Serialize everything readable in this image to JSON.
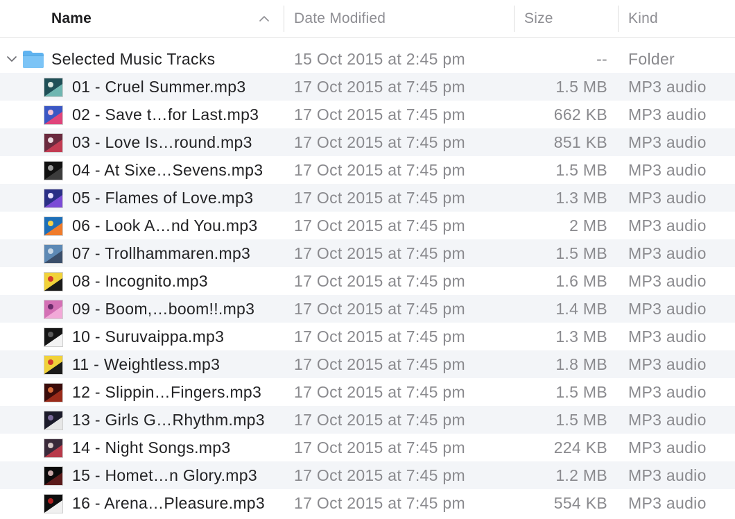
{
  "columns": {
    "name": "Name",
    "date_modified": "Date Modified",
    "size": "Size",
    "kind": "Kind",
    "sort": "ascending"
  },
  "folder": {
    "name": "Selected Music Tracks",
    "date_modified": "15 Oct 2015 at 2:45 pm",
    "size": "--",
    "kind": "Folder",
    "expanded": true
  },
  "files": [
    {
      "name": "01 - Cruel Summer.mp3",
      "date_modified": "17 Oct 2015 at 7:45 pm",
      "size": "1.5 MB",
      "kind": "MP3 audio",
      "art_colors": [
        "#1f4f57",
        "#6fb6b1",
        "#d9e6e0"
      ]
    },
    {
      "name": "02 - Save t…for Last.mp3",
      "date_modified": "17 Oct 2015 at 7:45 pm",
      "size": "662 KB",
      "kind": "MP3 audio",
      "art_colors": [
        "#3b57c4",
        "#e0447a",
        "#f4c2d6"
      ]
    },
    {
      "name": "03 - Love Is…round.mp3",
      "date_modified": "17 Oct 2015 at 7:45 pm",
      "size": "851 KB",
      "kind": "MP3 audio",
      "art_colors": [
        "#6a2a3e",
        "#c23b52",
        "#eadbe0"
      ]
    },
    {
      "name": "04 - At Sixe…Sevens.mp3",
      "date_modified": "17 Oct 2015 at 7:45 pm",
      "size": "1.5 MB",
      "kind": "MP3 audio",
      "art_colors": [
        "#111111",
        "#3c3c3c",
        "#9a9a9a"
      ]
    },
    {
      "name": "05 - Flames of Love.mp3",
      "date_modified": "17 Oct 2015 at 7:45 pm",
      "size": "1.3 MB",
      "kind": "MP3 audio",
      "art_colors": [
        "#2a2f86",
        "#7b4bd6",
        "#e9e1ff"
      ]
    },
    {
      "name": "06 - Look A…nd You.mp3",
      "date_modified": "17 Oct 2015 at 7:45 pm",
      "size": "2 MB",
      "kind": "MP3 audio",
      "art_colors": [
        "#1e6fb8",
        "#f07b2a",
        "#f6d24a"
      ]
    },
    {
      "name": "07 - Trollhammaren.mp3",
      "date_modified": "17 Oct 2015 at 7:45 pm",
      "size": "1.5 MB",
      "kind": "MP3 audio",
      "art_colors": [
        "#5d89b5",
        "#3a4e6a",
        "#c9d8e6"
      ]
    },
    {
      "name": "08 - Incognito.mp3",
      "date_modified": "17 Oct 2015 at 7:45 pm",
      "size": "1.6 MB",
      "kind": "MP3 audio",
      "art_colors": [
        "#f1d23a",
        "#1a1a1a",
        "#d33a2c"
      ]
    },
    {
      "name": "09 - Boom,…boom!!.mp3",
      "date_modified": "17 Oct 2015 at 7:45 pm",
      "size": "1.4 MB",
      "kind": "MP3 audio",
      "art_colors": [
        "#d470b5",
        "#f2a9d8",
        "#6a2a6a"
      ]
    },
    {
      "name": "10 - Suruvaippa.mp3",
      "date_modified": "17 Oct 2015 at 7:45 pm",
      "size": "1.3 MB",
      "kind": "MP3 audio",
      "art_colors": [
        "#151515",
        "#f3f3f3",
        "#5a5a5a"
      ]
    },
    {
      "name": "11 - Weightless.mp3",
      "date_modified": "17 Oct 2015 at 7:45 pm",
      "size": "1.8 MB",
      "kind": "MP3 audio",
      "art_colors": [
        "#f1d23a",
        "#1a1a1a",
        "#d33a2c"
      ]
    },
    {
      "name": "12 - Slippin…Fingers.mp3",
      "date_modified": "17 Oct 2015 at 7:45 pm",
      "size": "1.5 MB",
      "kind": "MP3 audio",
      "art_colors": [
        "#3a0c0a",
        "#9a2b1a",
        "#d46a3a"
      ]
    },
    {
      "name": "13 - Girls G…Rhythm.mp3",
      "date_modified": "17 Oct 2015 at 7:45 pm",
      "size": "1.5 MB",
      "kind": "MP3 audio",
      "art_colors": [
        "#1b1b2a",
        "#e7e7e7",
        "#7a6a9a"
      ]
    },
    {
      "name": "14 - Night Songs.mp3",
      "date_modified": "17 Oct 2015 at 7:45 pm",
      "size": "224 KB",
      "kind": "MP3 audio",
      "art_colors": [
        "#3a2a3a",
        "#b83a4a",
        "#d8c8c8"
      ]
    },
    {
      "name": "15 - Homet…n Glory.mp3",
      "date_modified": "17 Oct 2015 at 7:45 pm",
      "size": "1.2 MB",
      "kind": "MP3 audio",
      "art_colors": [
        "#0a0a0a",
        "#5a1a1a",
        "#c8a8a8"
      ]
    },
    {
      "name": "16 - Arena…Pleasure.mp3",
      "date_modified": "17 Oct 2015 at 7:45 pm",
      "size": "554 KB",
      "kind": "MP3 audio",
      "art_colors": [
        "#0e0e0e",
        "#f0f0f0",
        "#b02020"
      ]
    }
  ],
  "icons": {
    "sort": "chevron-up-icon",
    "disclosure": "chevron-down-icon",
    "folder": "folder-icon",
    "file": "album-art-icon"
  },
  "colors": {
    "folder_blue": "#5fb3f0",
    "stripe": "#f3f5f8",
    "header_text": "#8e8e93"
  }
}
